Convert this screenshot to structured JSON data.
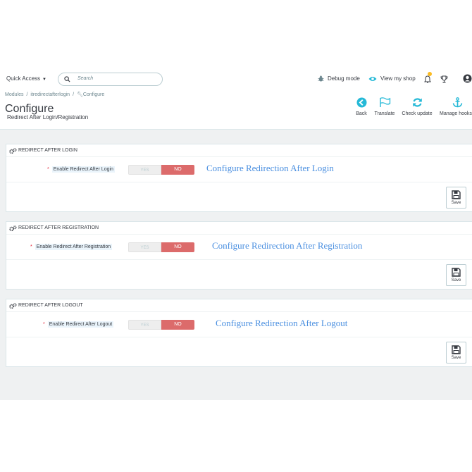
{
  "topbar": {
    "quick_access": "Quick Access",
    "search_placeholder": "Search",
    "debug_mode": "Debug mode",
    "view_my_shop": "View my shop"
  },
  "header": {
    "breadcrumb": [
      "Modules",
      "itredirectafterlogin",
      "Configure"
    ],
    "title": "Configure",
    "subtitle": "Redirect After Login/Registration",
    "actions": [
      {
        "label": "Back",
        "icon": "back-circle-icon"
      },
      {
        "label": "Translate",
        "icon": "flag-icon"
      },
      {
        "label": "Check update",
        "icon": "refresh-icon"
      },
      {
        "label": "Manage hooks",
        "icon": "anchor-icon"
      }
    ]
  },
  "panels": [
    {
      "title": "REDIRECT AFTER LOGIN",
      "field_label": "Enable Redirect After Login",
      "yes": "YES",
      "no": "NO",
      "note": "Configure Redirection After Login",
      "save": "Save"
    },
    {
      "title": "REDIRECT AFTER REGISTRATION",
      "field_label": "Enable Redirect After Registration",
      "yes": "YES",
      "no": "NO",
      "note": "Configure Redirection After Registration",
      "save": "Save"
    },
    {
      "title": "REDIRECT AFTER LOGOUT",
      "field_label": "Enable Redirect After Logout",
      "yes": "YES",
      "no": "NO",
      "note": "Configure Redirection After Logout",
      "save": "Save"
    }
  ],
  "colors": {
    "accent": "#25b9d7",
    "switch_no": "#dc6b6b",
    "note": "#4a8fe0",
    "notification_badge": "#fbbb22"
  }
}
